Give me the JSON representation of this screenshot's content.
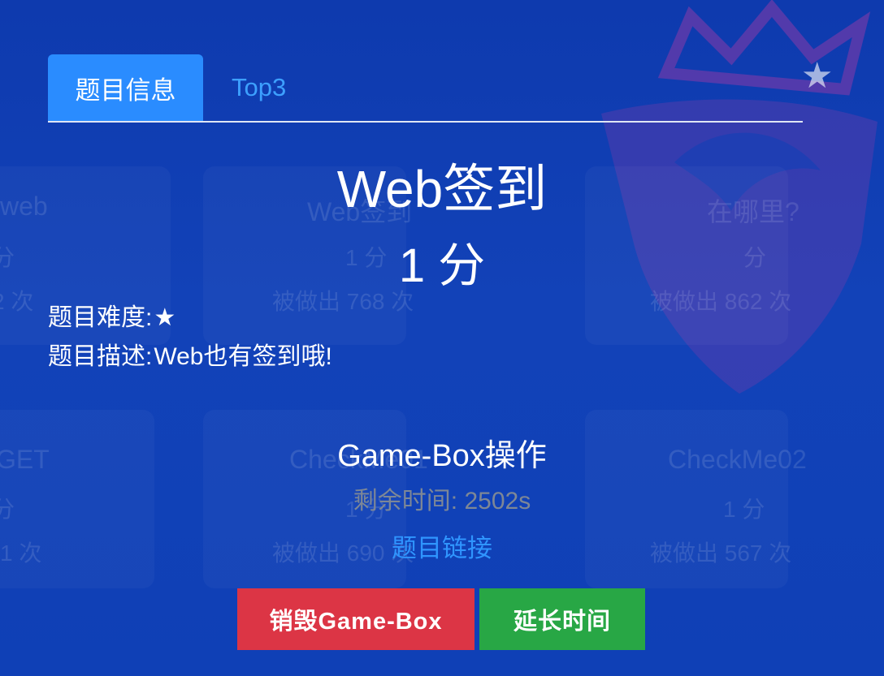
{
  "background": {
    "cards": [
      {
        "title": "web",
        "points": "分",
        "solves": "2 次"
      },
      {
        "title": "Web签到",
        "points": "1 分",
        "solves": "被做出 768 次"
      },
      {
        "title": "在哪里?",
        "points": "分",
        "solves": "被做出 862 次"
      },
      {
        "title": "GET",
        "points": "分",
        "solves": "1 次"
      },
      {
        "title": "CheckMe01",
        "points": "1 分",
        "solves": "被做出 690 次"
      },
      {
        "title": "CheckMe02",
        "points": "1 分",
        "solves": "被做出 567 次"
      }
    ]
  },
  "tabs": {
    "active": "题目信息",
    "other": "Top3"
  },
  "favorite_icon": "star-icon",
  "challenge": {
    "name": "Web签到",
    "points": "1 分",
    "difficulty_label": "题目难度:",
    "difficulty_value": "★",
    "description_label": "题目描述:",
    "description_value": "Web也有签到哦!"
  },
  "gamebox": {
    "title": "Game-Box操作",
    "time_left": "剩余时间: 2502s",
    "link_label": "题目链接",
    "destroy_label": "销毁Game-Box",
    "extend_label": "延长时间"
  },
  "colors": {
    "background": "#0f3fb3",
    "tab_active": "#2a8cff",
    "link": "#2f95ff",
    "danger": "#dc3545",
    "success": "#28a745"
  }
}
